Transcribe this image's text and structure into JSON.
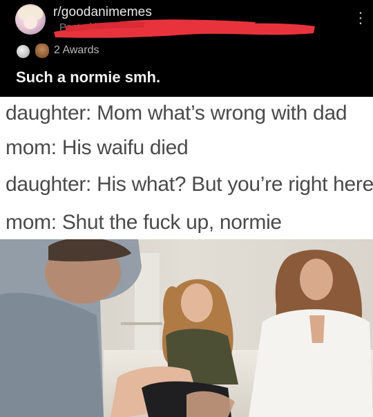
{
  "header": {
    "subreddit": "r/goodanimemes",
    "posted_by": "Posted by",
    "awards": "2 Awards",
    "title": "Such a normie smh."
  },
  "icons": {
    "avatar": "subreddit-avatar",
    "more": "more-vertical-icon",
    "award_1": "silver-award-icon",
    "award_2": "wholesome-award-icon"
  },
  "colors": {
    "background": "#000000",
    "redaction": "#e8333c",
    "meme_text": "#4a4a4a"
  },
  "meme": {
    "lines": [
      "daughter: Mom what’s wrong with dad",
      "mom: His waifu died",
      "daughter: His what? But you’re right here",
      "mom: Shut the fuck up, normie"
    ]
  }
}
